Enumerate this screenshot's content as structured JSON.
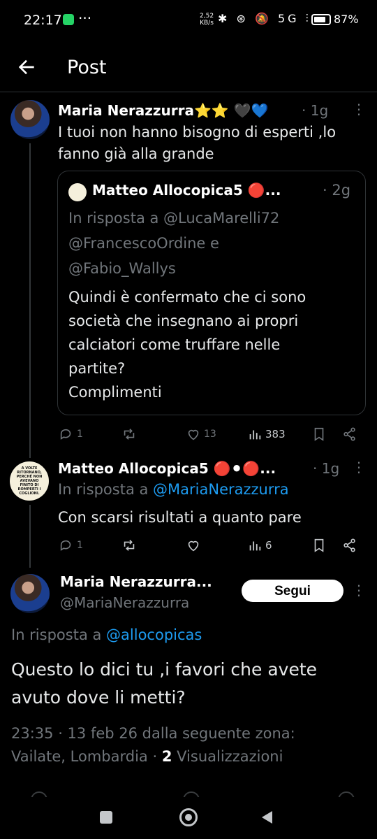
{
  "status_bar": {
    "time": "22:17",
    "more": "···",
    "speed_value": "2,52",
    "speed_unit": "KB/s",
    "icons": "✱ ⊛ 🔕 5G ⫶",
    "battery": "87%"
  },
  "header": {
    "title": "Post"
  },
  "tweet1": {
    "name": "Maria Nerazzurra⭐⭐ 🖤💙",
    "time": "· 1g",
    "text_line1": "I tuoi non hanno bisogno di esperti ,lo",
    "text_line2": "fanno già alla grande",
    "quote": {
      "name": "Matteo Allocopica5 🔴...",
      "time": "· 2g",
      "reply_line1": "In risposta a @LucaMarelli72",
      "reply_line2": "@FrancescoOrdine e",
      "reply_line3": "@Fabio_Wallys",
      "text_line1": "Quindi è confermato che ci sono",
      "text_line2": "società che insegnano ai propri",
      "text_line3": "calciatori come truffare nelle",
      "text_line4": "partite?",
      "text_line5": "Complimenti"
    },
    "replies": "1",
    "likes": "13",
    "views": "383"
  },
  "tweet2": {
    "name": "Matteo Allocopica5 🔴⚫🔴...",
    "time": "· 1g",
    "avatar_text": "A VOLTE RITORNANO, PERCHÉ NON AVEVANO FINITO DI ROMPERTI I COGLIONI.",
    "reply_prefix": "In risposta a",
    "reply_handle": "@MariaNerazzurra",
    "text": "Con scarsi risultati a quanto pare",
    "replies": "1",
    "views": "6"
  },
  "main_tweet": {
    "name": "Maria Nerazzurra...",
    "handle": "@MariaNerazzurra",
    "follow_label": "Segui",
    "reply_prefix": "In risposta a",
    "reply_handle": "@allocopicas",
    "text_line1": "Questo lo dici tu ,i favori che avete",
    "text_line2": "avuto dove li metti?",
    "meta_line1": "23:35 · 13 feb 26 dalla seguente zona:",
    "meta_location": "Vailate, Lombardia ·",
    "meta_views_count": "2",
    "meta_views_label": "Visualizzazioni"
  },
  "colors": {
    "accent": "#1d9bf0",
    "background": "#000000",
    "muted": "#71767b"
  }
}
